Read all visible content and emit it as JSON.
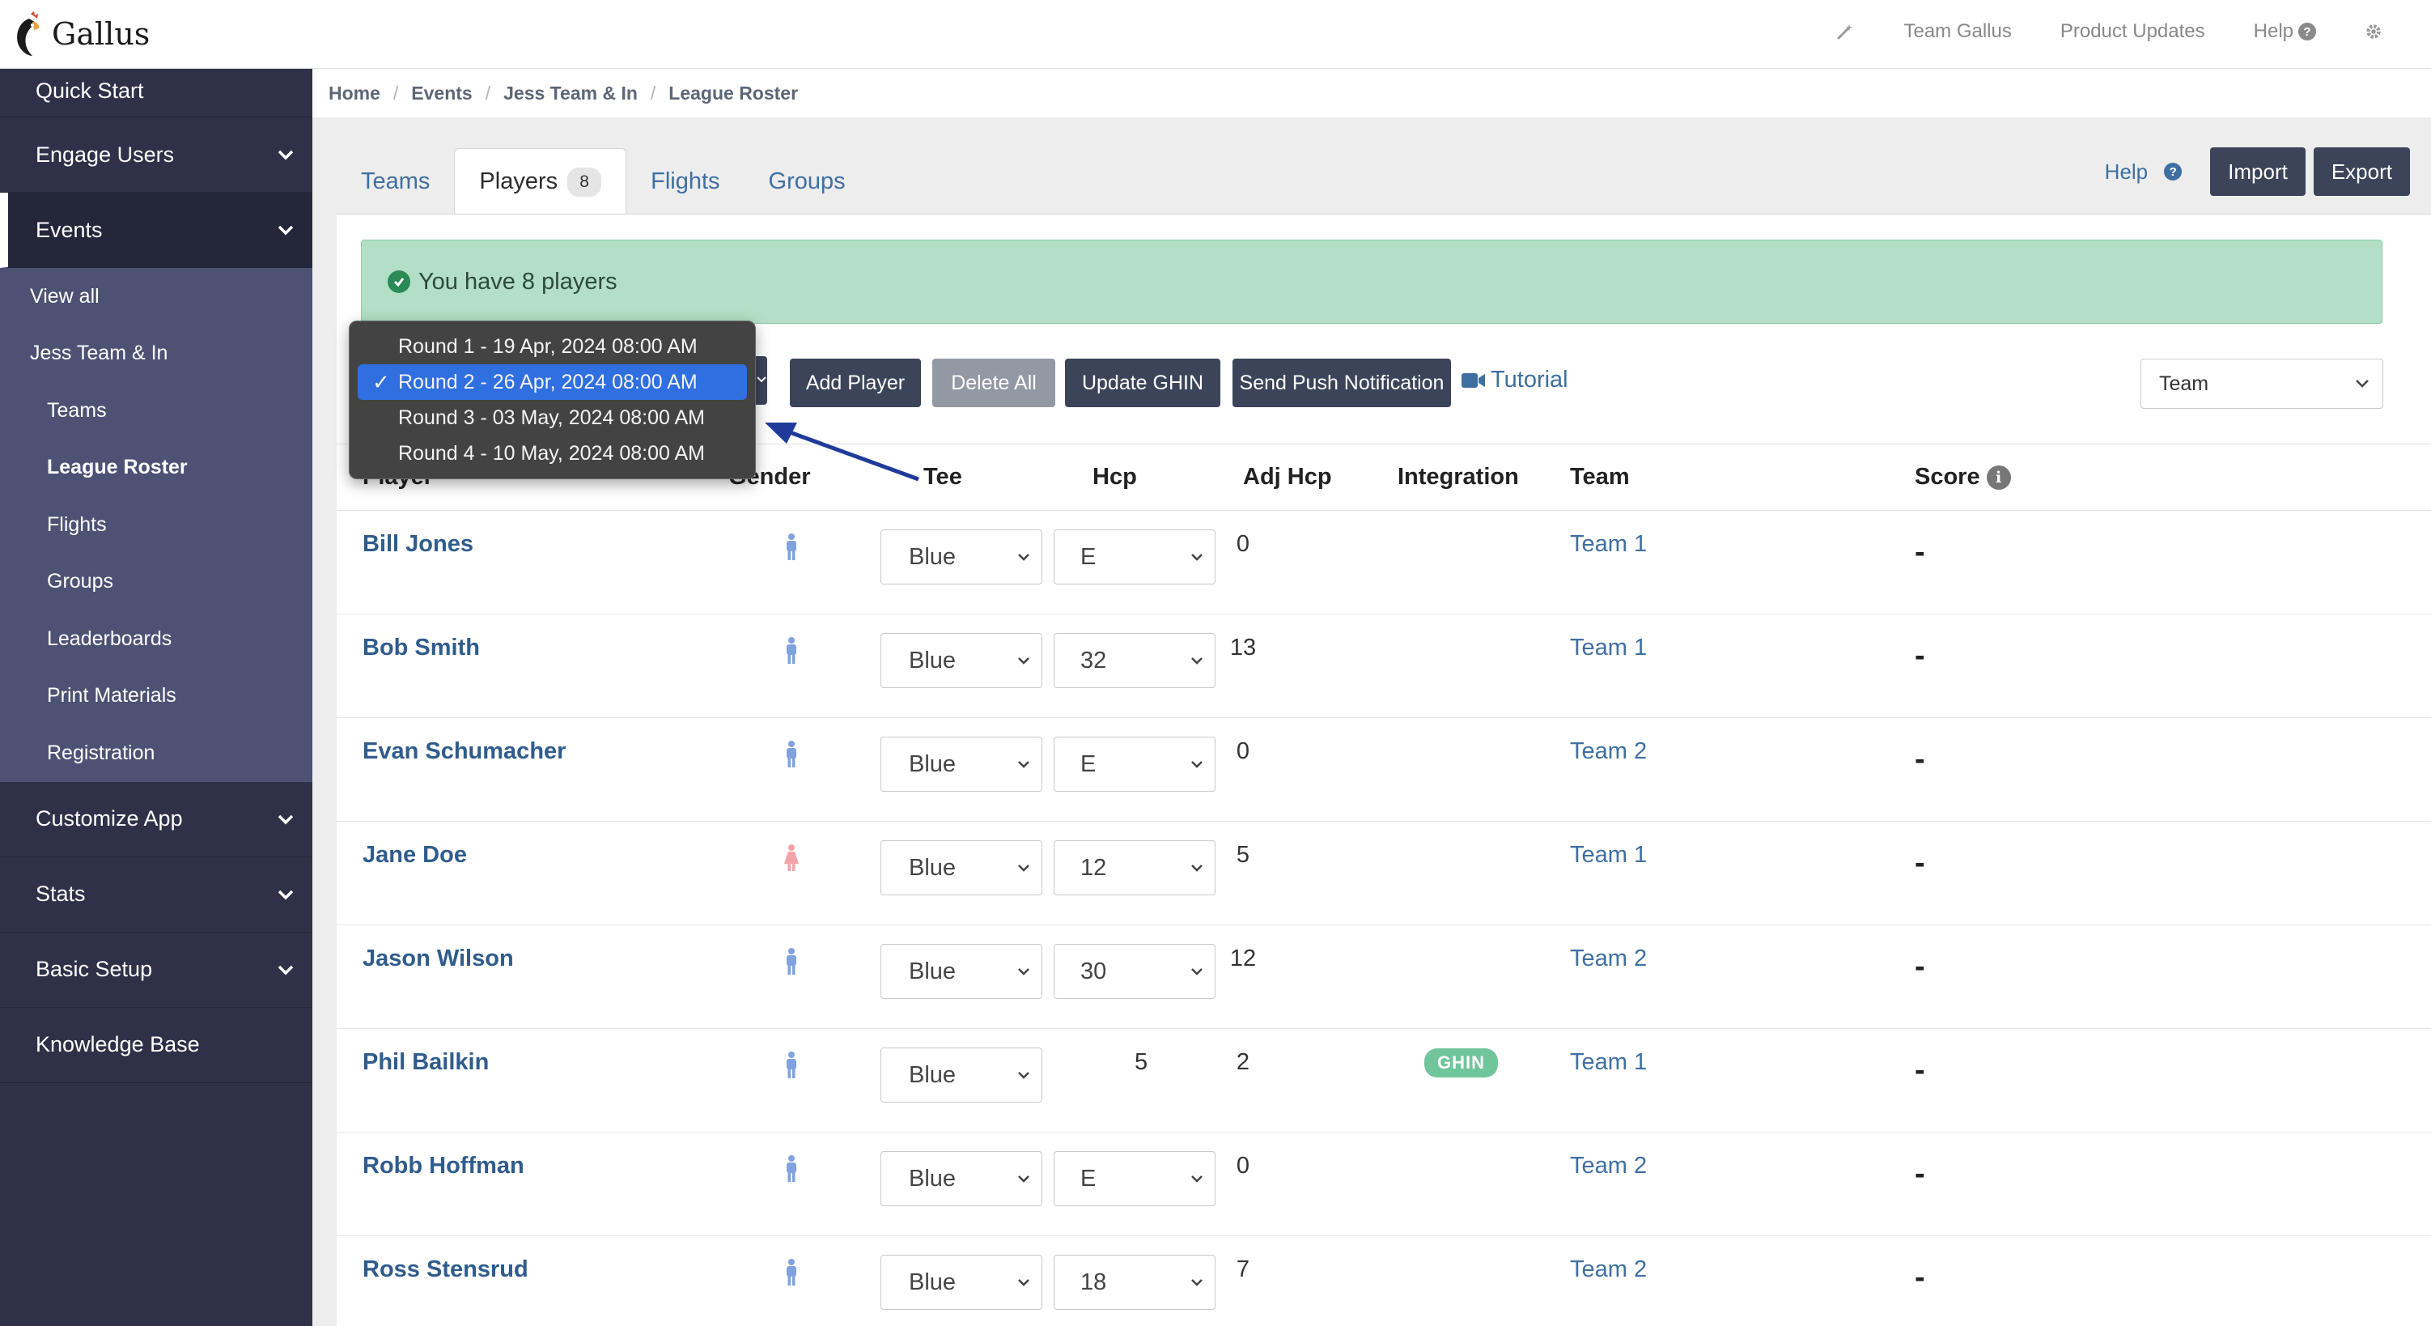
{
  "app": {
    "name": "Gallus"
  },
  "topnav": {
    "team": "Team Gallus",
    "updates": "Product Updates",
    "help": "Help"
  },
  "sidebar": {
    "quick_start": "Quick Start",
    "engage_users": "Engage Users",
    "events": "Events",
    "events_sub": {
      "view_all": "View all",
      "event_name": "Jess Team & In",
      "teams": "Teams",
      "league_roster": "League Roster",
      "flights": "Flights",
      "groups": "Groups",
      "leaderboards": "Leaderboards",
      "print_materials": "Print Materials",
      "registration": "Registration"
    },
    "customize_app": "Customize App",
    "stats": "Stats",
    "basic_setup": "Basic Setup",
    "knowledge_base": "Knowledge Base"
  },
  "breadcrumb": [
    "Home",
    "Events",
    "Jess Team & In",
    "League Roster"
  ],
  "tabs": [
    {
      "label": "Teams"
    },
    {
      "label": "Players",
      "count": "8"
    },
    {
      "label": "Flights"
    },
    {
      "label": "Groups"
    }
  ],
  "actions": {
    "help": "Help",
    "import": "Import",
    "export": "Export"
  },
  "alert": {
    "text": "You have 8 players"
  },
  "toolbar": {
    "add_player": "Add Player",
    "delete_all": "Delete All",
    "update_ghin": "Update GHIN",
    "send_push": "Send Push Notification",
    "tutorial": "Tutorial",
    "group_by": "Team"
  },
  "round_dropdown": {
    "options": [
      "Round 1 - 19 Apr, 2024 08:00 AM",
      "Round 2 - 26 Apr, 2024 08:00 AM",
      "Round 3 - 03 May, 2024 08:00 AM",
      "Round 4 - 10 May, 2024 08:00 AM"
    ],
    "selected_index": 1
  },
  "table": {
    "headers": {
      "player": "Player",
      "gender": "Gender",
      "tee": "Tee",
      "hcp": "Hcp",
      "adj_hcp": "Adj Hcp",
      "integration": "Integration",
      "team": "Team",
      "score": "Score"
    },
    "rows": [
      {
        "name": "Bill Jones",
        "gender": "male",
        "tee": "Blue",
        "hcp": "E",
        "hcp_editable": true,
        "adj": "0",
        "integration": "",
        "team": "Team 1",
        "score": "-"
      },
      {
        "name": "Bob Smith",
        "gender": "male",
        "tee": "Blue",
        "hcp": "32",
        "hcp_editable": true,
        "adj": "13",
        "integration": "",
        "team": "Team 1",
        "score": "-"
      },
      {
        "name": "Evan Schumacher",
        "gender": "male",
        "tee": "Blue",
        "hcp": "E",
        "hcp_editable": true,
        "adj": "0",
        "integration": "",
        "team": "Team 2",
        "score": "-"
      },
      {
        "name": "Jane Doe",
        "gender": "female",
        "tee": "Blue",
        "hcp": "12",
        "hcp_editable": true,
        "adj": "5",
        "integration": "",
        "team": "Team 1",
        "score": "-"
      },
      {
        "name": "Jason Wilson",
        "gender": "male",
        "tee": "Blue",
        "hcp": "30",
        "hcp_editable": true,
        "adj": "12",
        "integration": "",
        "team": "Team 2",
        "score": "-"
      },
      {
        "name": "Phil Bailkin",
        "gender": "male",
        "tee": "Blue",
        "hcp": "5",
        "hcp_editable": false,
        "adj": "2",
        "integration": "GHIN",
        "team": "Team 1",
        "score": "-"
      },
      {
        "name": "Robb Hoffman",
        "gender": "male",
        "tee": "Blue",
        "hcp": "E",
        "hcp_editable": true,
        "adj": "0",
        "integration": "",
        "team": "Team 2",
        "score": "-"
      },
      {
        "name": "Ross Stensrud",
        "gender": "male",
        "tee": "Blue",
        "hcp": "18",
        "hcp_editable": true,
        "adj": "7",
        "integration": "",
        "team": "Team 2",
        "score": "-"
      }
    ]
  },
  "colors": {
    "sidebar": "#2e3147",
    "sidebar_sub": "#4d5274",
    "link": "#3f6fa1",
    "alert": "#b2dfc5",
    "male": "#7fa3df",
    "female": "#f4a3a8",
    "ghin": "#70c59b"
  }
}
